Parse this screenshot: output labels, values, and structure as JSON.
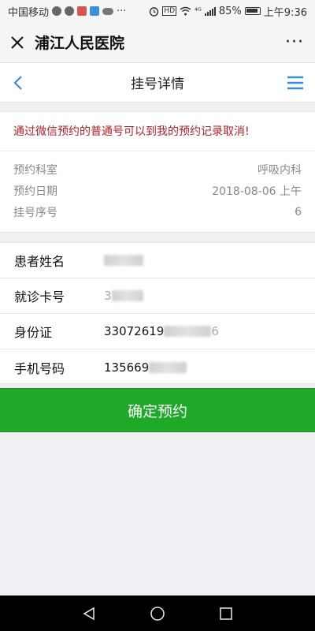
{
  "status_bar": {
    "carrier": "中国移动",
    "battery": "85%",
    "network": "⁴ᴳ",
    "time": "上午9:36",
    "hd": "HD"
  },
  "wechat_bar": {
    "title": "浦江人民医院",
    "more": "···"
  },
  "nav": {
    "title": "挂号详情"
  },
  "notice": {
    "text": "通过微信预约的普通号可以到我的预约记录取消!"
  },
  "appointment": [
    {
      "label": "预约科室",
      "value": "呼吸内科"
    },
    {
      "label": "预约日期",
      "value": "2018-08-06 上午"
    },
    {
      "label": "挂号序号",
      "value": "6"
    }
  ],
  "patient": {
    "name_label": "患者姓名",
    "card_label": "就诊卡号",
    "card_prefix": "3",
    "id_label": "身份证",
    "id_prefix": "33072619",
    "id_suffix": "6",
    "phone_label": "手机号码",
    "phone_prefix": "135669"
  },
  "submit_label": "确定预约",
  "colors": {
    "accent_green": "#1fa928",
    "notice_red": "#b3202b",
    "nav_blue": "#3b8fd8"
  }
}
